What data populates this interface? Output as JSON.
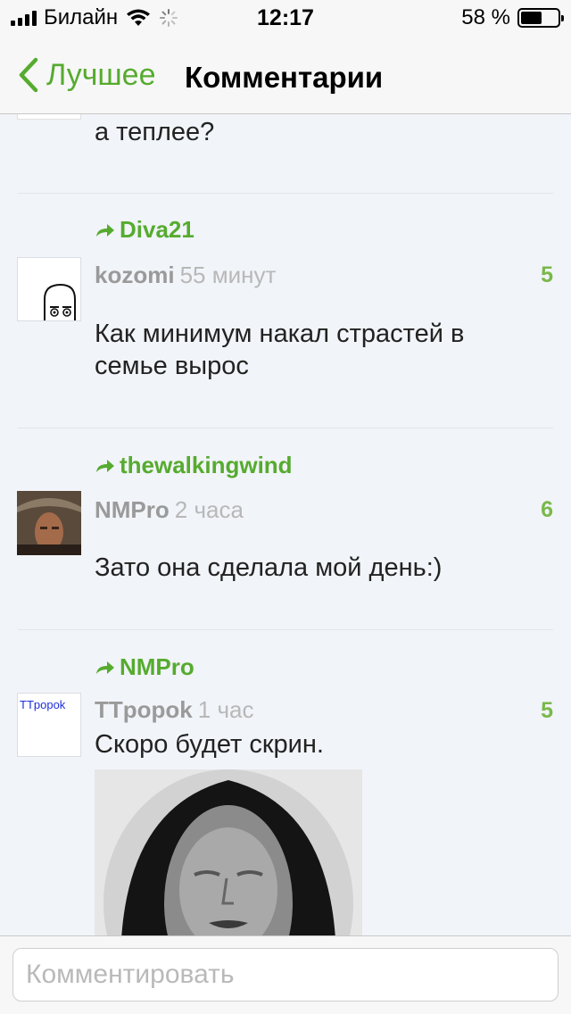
{
  "status_bar": {
    "carrier": "Билайн",
    "time": "12:17",
    "battery_percent": "58 %",
    "battery_level": 0.58
  },
  "nav": {
    "back_label": "Лучшее",
    "title": "Комментарии"
  },
  "comments": [
    {
      "text": "а теплее?"
    },
    {
      "reply_to": "Diva21",
      "user": "kozomi",
      "time": "55 минут",
      "score": "5",
      "text": "Как минимум накал страстей в семье вырос"
    },
    {
      "reply_to": "thewalkingwind",
      "user": "NMPro",
      "time": "2 часа",
      "score": "6",
      "text": "Зато она сделала мой день:)"
    },
    {
      "reply_to": "NMPro",
      "user": "TTpopok",
      "avatar_text": "TTpopok",
      "time": "1 час",
      "score": "5",
      "text": "Скоро будет скрин."
    }
  ],
  "input": {
    "placeholder": "Комментировать"
  },
  "colors": {
    "accent": "#56ab2f",
    "score": "#79b84a",
    "background": "#f1f4f8"
  }
}
